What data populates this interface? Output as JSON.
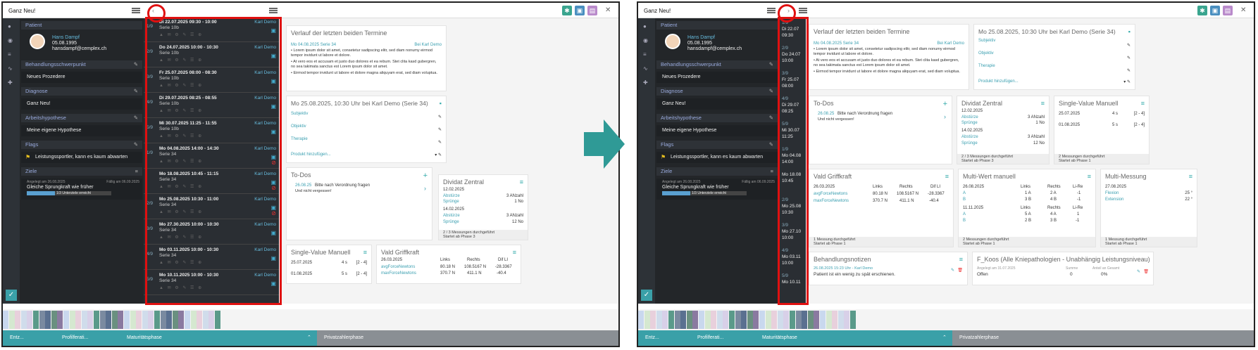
{
  "left_panel": {
    "app_title": "Ganz Neu!",
    "close": "✕",
    "patient": {
      "section": "Patient",
      "name": "Hans Dampf",
      "dob": "05.08.1995",
      "email": "hansdampf@cemplex.ch"
    },
    "sections": {
      "focus": "Behandlungsschwerpunkt",
      "focus_value": "Neues Prozedere",
      "diagnosis": "Diagnose",
      "diagnosis_value": "Ganz Neu!",
      "hypothesis": "Arbeitshypothese",
      "hypothesis_value": "Meine eigene Hypothese",
      "flags": "Flags",
      "flag_value": "Leistungssportler, kann es kaum abwarten",
      "goals": "Ziele",
      "goal_created": "Angelegt am 26.08.2025",
      "goal_due": "Fällig am 06.09.2025",
      "goal_value": "Gleiche Sprungkraft wie früher",
      "goal_progress_label": "1/3 Unterziele erreicht",
      "goal_progress": 0.33
    },
    "appointments": [
      {
        "count": "1/9",
        "date": "Di 22.07.2025 09:30 - 10:00",
        "series": "Serie 10b",
        "by": "Karl Demo",
        "warn": false
      },
      {
        "count": "2/9",
        "date": "Do 24.07.2025 10:00 - 10:30",
        "series": "Serie 10b",
        "by": "Karl Demo",
        "warn": false
      },
      {
        "count": "3/9",
        "date": "Fr 25.07.2025 08:00 - 08:30",
        "series": "Serie 10b",
        "by": "Karl Demo",
        "warn": false
      },
      {
        "count": "4/9",
        "date": "Di 29.07.2025 08:25 - 08:55",
        "series": "Serie 10b",
        "by": "Karl Demo",
        "warn": false
      },
      {
        "count": "5/9",
        "date": "Mi 30.07.2025 11:25 - 11:55",
        "series": "Serie 10b",
        "by": "Karl Demo",
        "warn": false
      },
      {
        "count": "1/9",
        "date": "Mo 04.08.2025 14:00 - 14:30",
        "series": "Serie 34",
        "by": "Karl Demo",
        "warn": true
      },
      {
        "count": "",
        "date": "Mo 18.08.2025 10:45 - 11:15",
        "series": "Serie 34",
        "by": "Karl Demo",
        "warn": true
      },
      {
        "count": "2/9",
        "date": "Mo 25.08.2025 10:30 - 11:00",
        "series": "Serie 34",
        "by": "Karl Demo",
        "warn": true
      },
      {
        "count": "3/9",
        "date": "Mo 27.30.2025 10:00 - 10:30",
        "series": "Serie 34",
        "by": "Karl Demo",
        "warn": false
      },
      {
        "count": "4/9",
        "date": "Mo 03.11.2025 10:00 - 10:30",
        "series": "Serie 34",
        "by": "Karl Demo",
        "warn": false
      },
      {
        "count": "5/9",
        "date": "Mo 10.11.2025 10:00 - 10:30",
        "series": "Serie 34",
        "by": "Karl Demo",
        "warn": false
      }
    ],
    "history_title": "Verlauf der letzten beiden Termine",
    "history_date": "Mo 04.08.2025 Serie 34",
    "history_by": "Bei Karl Demo",
    "history_lines": [
      "Lorem ipsum dolor sit amet, consetetur sadipscing elitr, sed diam nonumy eirmod tempor invidunt ut labore et dolore.",
      "At vero eos et accusam et justo duo dolores et ea rebum. Stet clita kasd gubergren, no sea takimata sanctus est Lorem ipsum dolor sit amet.",
      "Eirmod tempor invidunt ut labore et dolore magna aliquyam erat, sed diam voluptua."
    ],
    "session_title": "Mo 25.08.2025, 10:30 Uhr bei Karl Demo (Serie 34)",
    "session_fields": [
      "Subjektiv",
      "Objektiv",
      "Therapie"
    ],
    "add_product": "Produkt hinzufügen...",
    "todos_title": "To-Dos",
    "todo_date": "26.08.25",
    "todo_text": "Bitte nach Verordnung fragen",
    "todo_sub": "Und nicht vergessen!",
    "dividat": {
      "title": "Dividat Zentral",
      "groups": [
        {
          "date": "12.02.2025",
          "r1": "Abstürze",
          "v1": "3 ANzahl",
          "r2": "Sprünge",
          "v2": "1 No"
        },
        {
          "date": "14.02.2025",
          "r1": "Abstürze",
          "v1": "3 ANzahl",
          "r2": "Sprünge",
          "v2": "12 No"
        }
      ],
      "foot1": "2 / 3 Messungen durchgeführt",
      "foot2": "Startet ab Phase 3"
    },
    "single": {
      "title": "Single-Value Manuell",
      "rows": [
        {
          "d": "25.07.2025",
          "v": "4 s",
          "r": "[2 - 4]"
        },
        {
          "d": "01.08.2025",
          "v": "5 s",
          "r": "[2 - 4]"
        }
      ],
      "foot1": "2 Messungen durchgeführt",
      "foot2": "Startet ab Phase 1"
    },
    "vald": {
      "title": "Vald Griffkraft",
      "date": "26.03.2025",
      "cols": [
        "Links",
        "Rechts",
        "Dif LI"
      ],
      "rows": [
        {
          "n": "avgForceNewtons",
          "a": "80.18 N",
          "b": "108.5167 N",
          "c": "-28.3367"
        },
        {
          "n": "maxForceNewtons",
          "a": "370.7 N",
          "b": "411.1 N",
          "c": "-40.4"
        }
      ],
      "foot1": "1 Messung durchgeführt",
      "foot2": "Startet ab Phase 1"
    },
    "phases": [
      "Entz...",
      "Profilferati...",
      "Maturitätsphase",
      "Privatzahlerphase"
    ]
  },
  "right_panel": {
    "narrow_appts": [
      {
        "c": "1/9",
        "d1": "Di 22.07",
        "d2": "09:30"
      },
      {
        "c": "2/9",
        "d1": "Do 24.07",
        "d2": "10:00"
      },
      {
        "c": "3/9",
        "d1": "Fr 25.07",
        "d2": "08:00"
      },
      {
        "c": "4/9",
        "d1": "Di 29.07",
        "d2": "08:25"
      },
      {
        "c": "5/9",
        "d1": "Mi 30.07",
        "d2": "11:25"
      },
      {
        "c": "1/9",
        "d1": "Mo 04.08",
        "d2": "14:00"
      },
      {
        "c": "",
        "d1": "Mo 18.08",
        "d2": "10:45"
      },
      {
        "c": "2/9",
        "d1": "Mo 25.08",
        "d2": "10:30"
      },
      {
        "c": "3/9",
        "d1": "Mo 27.10",
        "d2": "10:00"
      },
      {
        "c": "4/9",
        "d1": "Mo 03.11",
        "d2": "10:00"
      },
      {
        "c": "5/9",
        "d1": "Mo 10.11",
        "d2": ""
      }
    ],
    "multi": {
      "title": "Multi-Wert manuell",
      "cols": [
        "Links",
        "Rechts",
        "Li-Re"
      ],
      "g1": {
        "date": "26.08.2025",
        "rows": [
          {
            "n": "A",
            "a": "1 A",
            "b": "2 A",
            "c": "-1"
          },
          {
            "n": "B",
            "a": "3 B",
            "b": "4 B",
            "c": "-1"
          }
        ]
      },
      "g2": {
        "date": "11.11.2025",
        "rows": [
          {
            "n": "A",
            "a": "5 A",
            "b": "4 A",
            "c": "1"
          },
          {
            "n": "B",
            "a": "2 B",
            "b": "3 B",
            "c": "-1"
          }
        ]
      },
      "foot1": "2 Messungen durchgeführt",
      "foot2": "Startet ab Phase 1"
    },
    "multim": {
      "title": "Multi-Messung",
      "date": "27.08.2025",
      "rows": [
        {
          "n": "Flexion",
          "v": "25 °"
        },
        {
          "n": "Extension",
          "v": "22 °"
        }
      ],
      "foot1": "1 Messung durchgeführt",
      "foot2": "Startet ab Phase 1"
    },
    "notes": {
      "title": "Behandlungsnotizen",
      "meta": "26.08.2025 15:23 Uhr - Karl Demo",
      "text": "Patient ist ein wenig zu spät erschienen."
    },
    "koos": {
      "title": "F_Koos (Alle Kniepathologien - Unabhängig Leistungsniveau)",
      "created": "Angelegt am 31.07.2025",
      "status": "Offen",
      "sum_label": "Summe",
      "sum": "0",
      "pct_label": "Anteil an Gesamt",
      "pct": "0%"
    }
  }
}
